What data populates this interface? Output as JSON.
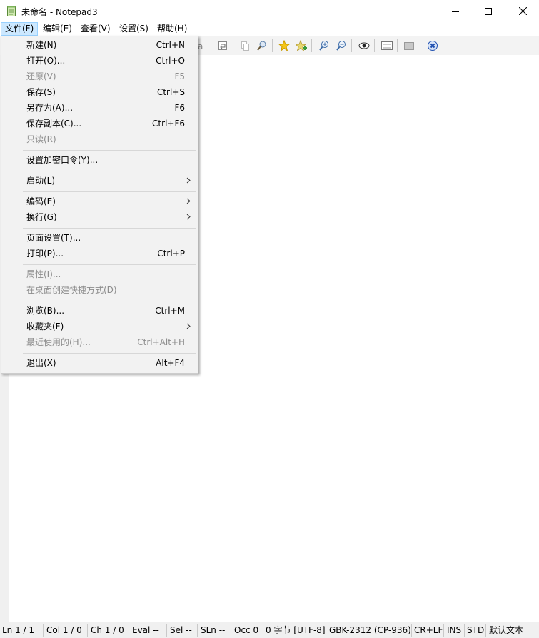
{
  "window": {
    "title": "未命名 - Notepad3"
  },
  "menubar": {
    "items": [
      "文件(F)",
      "编辑(E)",
      "查看(V)",
      "设置(S)",
      "帮助(H)"
    ]
  },
  "file_menu": {
    "groups": [
      [
        {
          "label": "新建(N)",
          "shortcut": "Ctrl+N"
        },
        {
          "label": "打开(O)...",
          "shortcut": "Ctrl+O"
        },
        {
          "label": "还原(V)",
          "shortcut": "F5",
          "disabled": true
        },
        {
          "label": "保存(S)",
          "shortcut": "Ctrl+S"
        },
        {
          "label": "另存为(A)...",
          "shortcut": "F6"
        },
        {
          "label": "保存副本(C)...",
          "shortcut": "Ctrl+F6"
        },
        {
          "label": "只读(R)",
          "shortcut": "",
          "disabled": true
        }
      ],
      [
        {
          "label": "设置加密口令(Y)...",
          "shortcut": ""
        }
      ],
      [
        {
          "label": "启动(L)",
          "shortcut": "",
          "submenu": true
        }
      ],
      [
        {
          "label": "编码(E)",
          "shortcut": "",
          "submenu": true
        },
        {
          "label": "换行(G)",
          "shortcut": "",
          "submenu": true
        }
      ],
      [
        {
          "label": "页面设置(T)...",
          "shortcut": ""
        },
        {
          "label": "打印(P)...",
          "shortcut": "Ctrl+P"
        }
      ],
      [
        {
          "label": "属性(I)...",
          "shortcut": "",
          "disabled": true
        },
        {
          "label": "在桌面创建快捷方式(D)",
          "shortcut": "",
          "disabled": true
        }
      ],
      [
        {
          "label": "浏览(B)...",
          "shortcut": "Ctrl+M"
        },
        {
          "label": "收藏夹(F)",
          "shortcut": "",
          "submenu": true
        },
        {
          "label": "最近使用的(H)...",
          "shortcut": "Ctrl+Alt+H",
          "disabled": true
        }
      ],
      [
        {
          "label": "退出(X)",
          "shortcut": "Alt+F4"
        }
      ]
    ]
  },
  "statusbar": {
    "cells": [
      "Ln  1 / 1",
      "Col  1 / 0",
      "Ch  1 / 0",
      "Eval  --",
      "Sel  --",
      "SLn  --",
      "Occ  0",
      "0 字节 [UTF-8]",
      "GBK-2312 (CP-936)",
      "CR+LF",
      "INS",
      "STD",
      "默认文本"
    ]
  },
  "colors": {
    "menu_highlight": "#cce8ff",
    "long_line_marker": "#f0c050",
    "menu_background": "#f2f2f2"
  }
}
